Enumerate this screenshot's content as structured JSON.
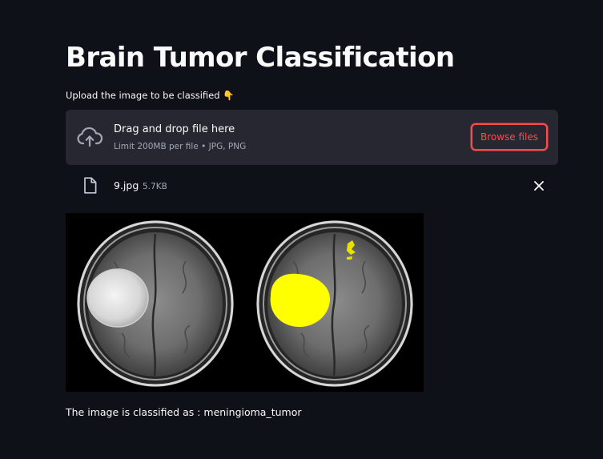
{
  "page": {
    "title": "Brain Tumor Classification",
    "upload_label": "Upload the image to be classified 👇"
  },
  "uploader": {
    "icon": "cloud-upload-icon",
    "instructions": "Drag and drop file here",
    "limits": "Limit 200MB per file • JPG, PNG",
    "browse_label": "Browse files",
    "accent_color": "#ff4b4b"
  },
  "uploaded_file": {
    "icon": "file-icon",
    "name": "9.jpg",
    "size": "5.7KB",
    "delete_icon": "close-icon"
  },
  "result": {
    "text": "The image is classified as : meningioma_tumor"
  },
  "colors": {
    "background": "#0e1117",
    "panel": "#262730",
    "text": "#fafafa",
    "muted_text": "#a3a8b8",
    "accent": "#ff4b4b",
    "highlight": "#ffff00"
  }
}
